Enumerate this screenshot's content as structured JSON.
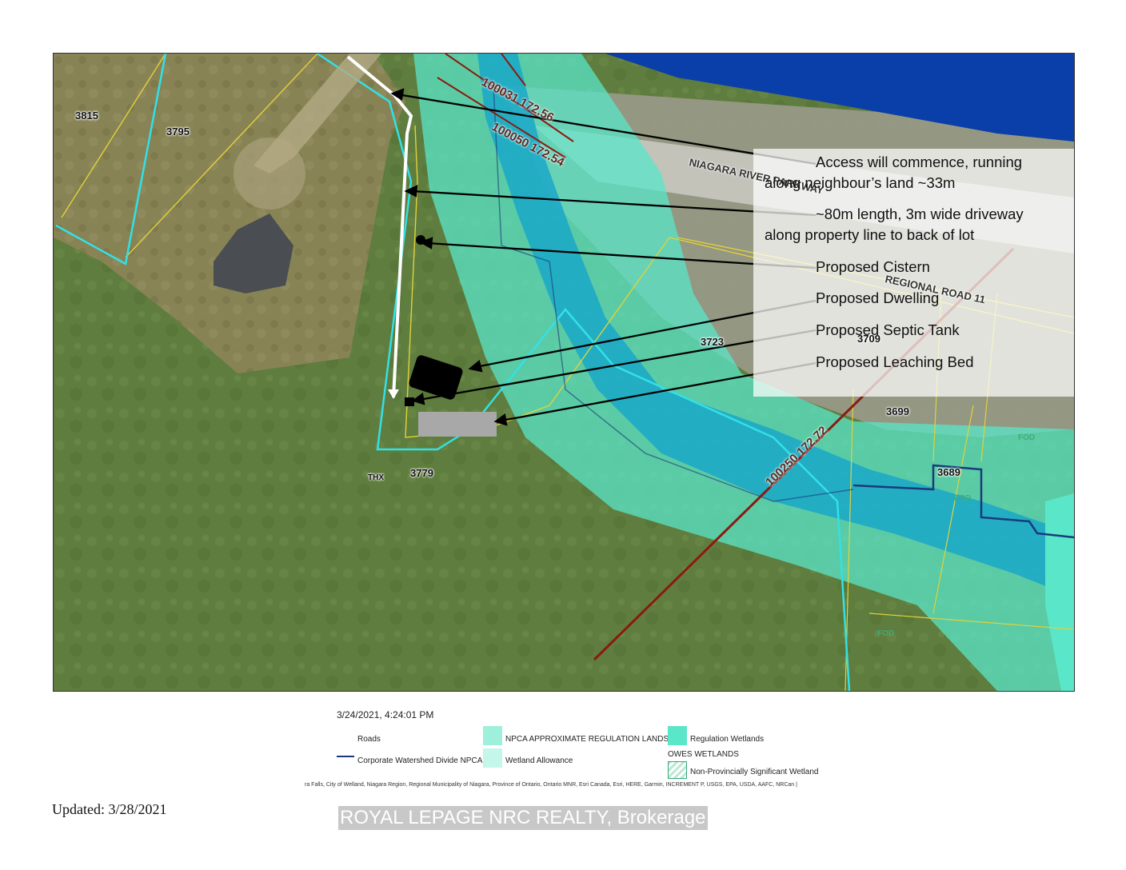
{
  "colors": {
    "regulation_lands": "#5ae6c8",
    "wetland": "#1aa8c8",
    "water": "#0a3ea8",
    "parcel_line": "#e0d23a",
    "property_outline": "#33e0e8",
    "watershed_divide": "#1a3a7a",
    "transect": "#8a1a10",
    "grass": "#5f7d3e"
  },
  "map": {
    "parcels": [
      "3815",
      "3795",
      "3723",
      "3709",
      "3699",
      "3689",
      "3779",
      "THX",
      "FOD",
      "FOD",
      "FOD"
    ],
    "road_label_1": "NIAGARA RIVER PARKWAY",
    "road_label_2": "REGIONAL ROAD 11",
    "transect_ids": [
      "100031 172.56",
      "100050 172.54",
      "100250 172.72"
    ]
  },
  "callouts": [
    {
      "line1": "Access will commence, running",
      "line2": "along neighbour’s land ~33m"
    },
    {
      "line1": "~80m length, 3m wide driveway",
      "line2": "along property line to back of lot"
    },
    {
      "line1": "Proposed Cistern"
    },
    {
      "line1": "Proposed Dwelling"
    },
    {
      "line1": "Proposed Septic Tank"
    },
    {
      "line1": "Proposed Leaching Bed"
    }
  ],
  "legend": {
    "timestamp": "3/24/2021, 4:24:01 PM",
    "roads": "Roads",
    "corporate_watershed": "Corporate Watershed Divide NPCA",
    "npca_regulation": "NPCA APPROXIMATE REGULATION LANDS",
    "wetland_allowance": "Wetland Allowance",
    "regulation_wetlands": "Regulation Wetlands",
    "owes_wetlands": "OWES WETLANDS",
    "non_provincial": "Non-Provincially Significant Wetland",
    "attribution": "ra Falls, City of Welland, Niagara Region, Regional Municipality of Niagara, Province of Ontario, Ontario MNR, Esri Canada, Esri, HERE, Garmin, INCREMENT P, USGS, EPA, USDA, AAFC, NRCan |"
  },
  "footer": {
    "updated": "Updated: 3/28/2021",
    "watermark": "ROYAL LEPAGE NRC REALTY, Brokerage"
  }
}
